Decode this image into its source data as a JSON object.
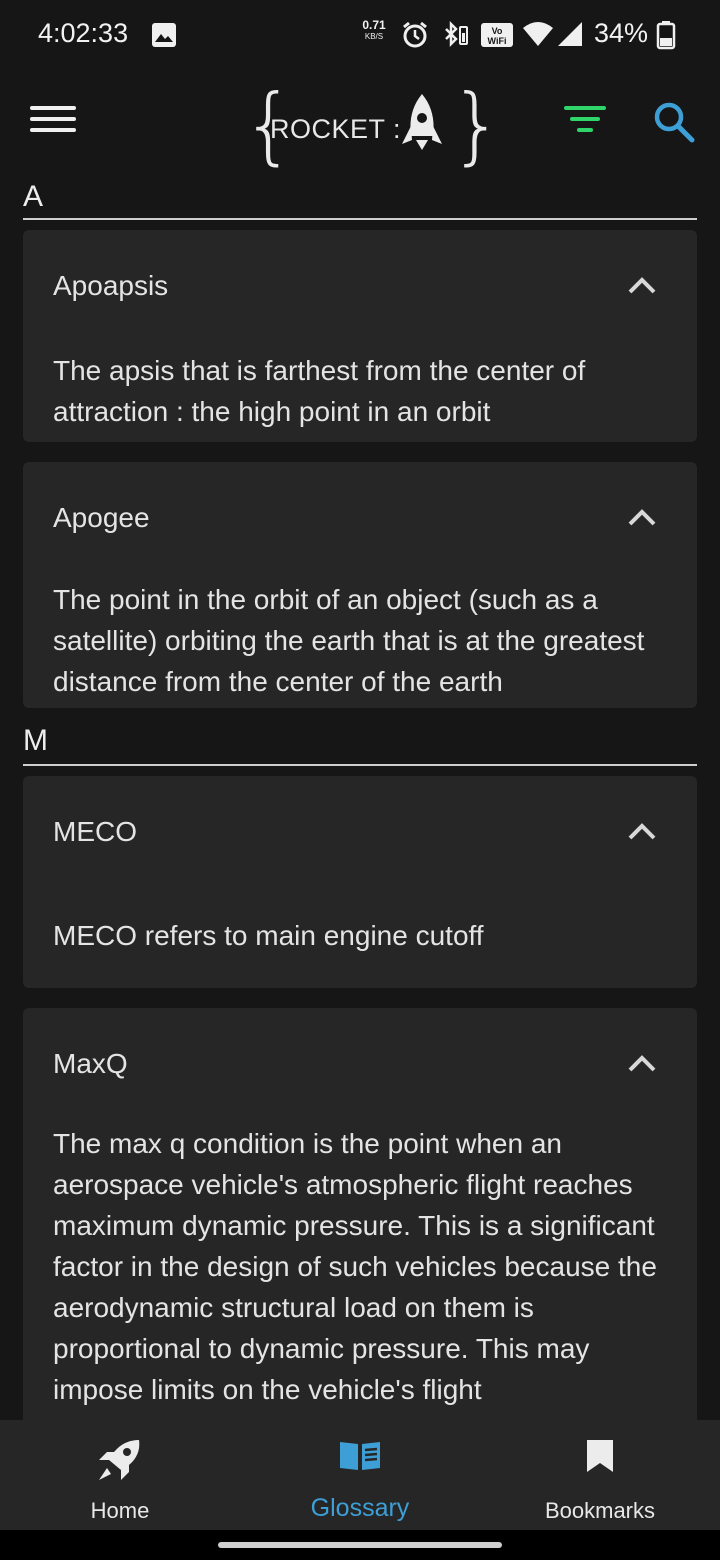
{
  "status_bar": {
    "time": "4:02:33",
    "net_speed_value": "0.71",
    "net_speed_unit": "KB/S",
    "wifi_badge": "VoWiFi",
    "battery_percent": "34%"
  },
  "header": {
    "logo_text": "ROCKET :",
    "accent_color": "#2fd46a",
    "search_color": "#3d9fd6"
  },
  "sections": [
    {
      "letter": "A",
      "terms": [
        {
          "title": "Apoapsis",
          "definition": "The apsis that is farthest from the center of attraction : the high point in an orbit"
        },
        {
          "title": "Apogee",
          "definition": "The point in the orbit of an object (such as a satellite) orbiting the earth that is at the greatest distance from the center of the earth"
        }
      ]
    },
    {
      "letter": "M",
      "terms": [
        {
          "title": "MECO",
          "definition": "MECO refers to main engine cutoff"
        },
        {
          "title": "MaxQ",
          "definition": "The max q condition is the point when an aerospace vehicle's atmospheric flight reaches maximum dynamic pressure. This is a significant factor in the design of such vehicles because the aerodynamic structural load on them is proportional to dynamic pressure. This may impose limits on the vehicle's flight"
        }
      ]
    }
  ],
  "bottom_nav": {
    "items": [
      {
        "label": "Home",
        "icon": "rocket-icon"
      },
      {
        "label": "Glossary",
        "icon": "book-icon",
        "active": true
      },
      {
        "label": "Bookmarks",
        "icon": "bookmark-icon"
      }
    ]
  }
}
